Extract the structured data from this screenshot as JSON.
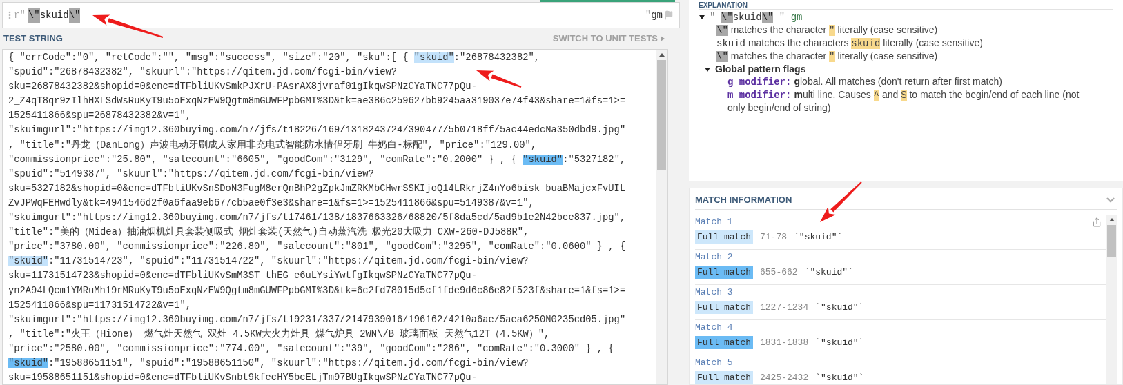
{
  "regex": {
    "open_delimiter": "r\"",
    "segments": [
      {
        "kind": "escape",
        "text": "\\\""
      },
      {
        "kind": "literal",
        "text": "skuid"
      },
      {
        "kind": "escape",
        "text": "\\\""
      }
    ],
    "close_delimiter": "\"",
    "flags": "gm"
  },
  "test_string": {
    "title": "TEST STRING",
    "switch_link": "SWITCH TO UNIT TESTS",
    "lines": [
      {
        "segments": [
          {
            "text": "{ \"errCode\":\"0\", \"retCode\":\"\", \"msg\":\"success\", \"size\":\"20\", \"sku\":[ { "
          },
          {
            "text": "\"skuid\"",
            "color": "#c3e2fb"
          },
          {
            "text": ":\"26878432382\","
          }
        ]
      },
      {
        "segments": [
          {
            "text": "\"spuid\":\"26878432382\", \"skuurl\":\"https://qitem.jd.com/fcgi-bin/view?"
          }
        ]
      },
      {
        "segments": [
          {
            "text": "sku=26878432382&shopid=0&enc=dTFbliUKvSmkPJXrU-PAsrAX8jvraf01gIkqwSPNzCYaTNC77pQu-"
          }
        ]
      },
      {
        "segments": [
          {
            "text": "2_Z4qT8qr9zIlhHXLSdWsRuKyT9u5oExqNzEW9Qgtm8mGUWFPpbGMI%3D&tk=ae386c259627bb9245aa319037e74f43&share=1&fs=1>="
          }
        ]
      },
      {
        "segments": [
          {
            "text": "1525411866&spu=26878432382&v=1\","
          }
        ]
      },
      {
        "segments": [
          {
            "text": "\"skuimgurl\":\"https://img12.360buyimg.com/n7/jfs/t18226/169/1318243724/390477/5b0718ff/5ac44edcNa350dbd9.jpg\""
          }
        ]
      },
      {
        "segments": [
          {
            "text": ", \"title\":\"丹龙（DanLong）声波电动牙刷成人家用非充电式智能防水情侣牙刷 牛奶白-标配\", \"price\":\"129.00\","
          }
        ]
      },
      {
        "segments": [
          {
            "text": "\"commissionprice\":\"25.80\", \"salecount\":\"6605\", \"goodCom\":\"3129\", \"comRate\":\"0.2000\" } , { "
          },
          {
            "text": "\"skuid\"",
            "color": "#6bbbf4"
          },
          {
            "text": ":\"5327182\","
          }
        ]
      },
      {
        "segments": [
          {
            "text": "\"spuid\":\"5149387\", \"skuurl\":\"https://qitem.jd.com/fcgi-bin/view?"
          }
        ]
      },
      {
        "segments": [
          {
            "text": "sku=5327182&shopid=0&enc=dTFbliUKvSnSDoN3FugM8erQnBhP2gZpkJmZRKMbCHwrSSKIjoQ14LRkrjZ4nYo6bisk_buaBMajcxFvUIL"
          }
        ]
      },
      {
        "segments": [
          {
            "text": "ZvJPWqFEHwdly&tk=4941546d2f0a6faa9eb677cb5ae0f3e3&share=1&fs=1>=1525411866&spu=5149387&v=1\","
          }
        ]
      },
      {
        "segments": [
          {
            "text": "\"skuimgurl\":\"https://img12.360buyimg.com/n7/jfs/t17461/138/1837663326/68820/5f8da5cd/5ad9b1e2N42bce837.jpg\","
          }
        ]
      },
      {
        "segments": [
          {
            "text": "\"title\":\"美的（Midea）抽油烟机灶具套装侧吸式 烟灶套装(天然气)自动蒸汽洗 极光20大吸力 CXW-260-DJ588R\","
          }
        ]
      },
      {
        "segments": [
          {
            "text": "\"price\":\"3780.00\", \"commissionprice\":\"226.80\", \"salecount\":\"801\", \"goodCom\":\"3295\", \"comRate\":\"0.0600\" } , {"
          }
        ]
      },
      {
        "segments": [
          {
            "text": "\"skuid\"",
            "color": "#c3e2fb"
          },
          {
            "text": ":\"11731514723\", \"spuid\":\"11731514722\", \"skuurl\":\"https://qitem.jd.com/fcgi-bin/view?"
          }
        ]
      },
      {
        "segments": [
          {
            "text": "sku=11731514723&shopid=0&enc=dTFbliUKvSmM3ST_thEG_e6uLYsiYwtfgIkqwSPNzCYaTNC77pQu-"
          }
        ]
      },
      {
        "segments": [
          {
            "text": "yn2A94LQcm1YMRuMh19rMRuKyT9u5oExqNzEW9Qgtm8mGUWFPpbGMI%3D&tk=6c2fd78015d5cf1fde9d6c86e82f523f&share=1&fs=1>="
          }
        ]
      },
      {
        "segments": [
          {
            "text": "1525411866&spu=11731514722&v=1\","
          }
        ]
      },
      {
        "segments": [
          {
            "text": "\"skuimgurl\":\"https://img12.360buyimg.com/n7/jfs/t19231/337/2147939016/196162/4210a6ae/5aea6250N0235cd05.jpg\""
          }
        ]
      },
      {
        "segments": [
          {
            "text": ", \"title\":\"火王（Hione） 燃气灶天然气 双灶 4.5KW大火力灶具 煤气炉具 2WN\\/B 玻璃面板 天然气12T（4.5KW）\","
          }
        ]
      },
      {
        "segments": [
          {
            "text": "\"price\":\"2580.00\", \"commissionprice\":\"774.00\", \"salecount\":\"39\", \"goodCom\":\"286\", \"comRate\":\"0.3000\" } , {"
          }
        ]
      },
      {
        "segments": [
          {
            "text": "\"skuid\"",
            "color": "#6bbbf4"
          },
          {
            "text": ":\"19588651151\", \"spuid\":\"19588651150\", \"skuurl\":\"https://qitem.jd.com/fcgi-bin/view?"
          }
        ]
      },
      {
        "segments": [
          {
            "text": "sku=19588651151&shopid=0&enc=dTFbliUKvSnbt9kfecHY5bcELjTm97BUgIkqwSPNzCYaTNC77pQu-"
          }
        ]
      }
    ]
  },
  "explanation": {
    "title": "EXPLANATION",
    "tree": {
      "expanded": true,
      "segments": [
        {
          "kind": "quote",
          "text": "\" "
        },
        {
          "kind": "escape",
          "text": "\\\""
        },
        {
          "kind": "mono",
          "text": "skuid"
        },
        {
          "kind": "escape",
          "text": "\\\""
        },
        {
          "kind": "quote",
          "text": " \" "
        },
        {
          "kind": "flags",
          "text": "gm"
        }
      ],
      "children": [
        {
          "segments": [
            {
              "kind": "escape",
              "text": "\\\""
            },
            {
              "kind": "text",
              "text": " matches the character "
            },
            {
              "kind": "mark",
              "text": "\""
            },
            {
              "kind": "text",
              "text": " literally (case sensitive)"
            }
          ]
        },
        {
          "segments": [
            {
              "kind": "mono",
              "text": "skuid"
            },
            {
              "kind": "text",
              "text": " matches the characters "
            },
            {
              "kind": "mark",
              "text": "skuid"
            },
            {
              "kind": "text",
              "text": " literally (case sensitive)"
            }
          ]
        },
        {
          "segments": [
            {
              "kind": "escape",
              "text": "\\\""
            },
            {
              "kind": "text",
              "text": " matches the character "
            },
            {
              "kind": "mark",
              "text": "\""
            },
            {
              "kind": "text",
              "text": " literally (case sensitive)"
            }
          ]
        },
        {
          "expanded": true,
          "segments": [
            {
              "kind": "bold",
              "text": "Global pattern flags"
            }
          ],
          "children": [
            {
              "segments": [
                {
                  "kind": "flag",
                  "text": "g modifier:"
                },
                {
                  "kind": "bold",
                  "text": "g"
                },
                {
                  "kind": "text",
                  "text": "lobal. All matches (don't return after first match)"
                }
              ]
            },
            {
              "segments": [
                {
                  "kind": "flag",
                  "text": "m modifier:"
                },
                {
                  "kind": "bold",
                  "text": "m"
                },
                {
                  "kind": "text",
                  "text": "ulti line. Causes "
                },
                {
                  "kind": "mark",
                  "text": "^"
                },
                {
                  "kind": "text",
                  "text": " and "
                },
                {
                  "kind": "mark",
                  "text": "$"
                },
                {
                  "kind": "text",
                  "text": " to match the begin/end of each line (not only begin/end of string)"
                }
              ]
            }
          ]
        }
      ]
    }
  },
  "match_information": {
    "title": "MATCH INFORMATION",
    "matches": [
      {
        "title": "Match 1",
        "label": "Full match",
        "range": "71-78",
        "value": "`\"skuid\"`",
        "color": "#cde7fb"
      },
      {
        "title": "Match 2",
        "label": "Full match",
        "range": "655-662",
        "value": "`\"skuid\"`",
        "color": "#6bbbf4"
      },
      {
        "title": "Match 3",
        "label": "Full match",
        "range": "1227-1234",
        "value": "`\"skuid\"`",
        "color": "#cde7fb"
      },
      {
        "title": "Match 4",
        "label": "Full match",
        "range": "1831-1838",
        "value": "`\"skuid\"`",
        "color": "#6bbbf4"
      },
      {
        "title": "Match 5",
        "label": "Full match",
        "range": "2425-2432",
        "value": "`\"skuid\"`",
        "color": "#cde7fb"
      }
    ]
  }
}
